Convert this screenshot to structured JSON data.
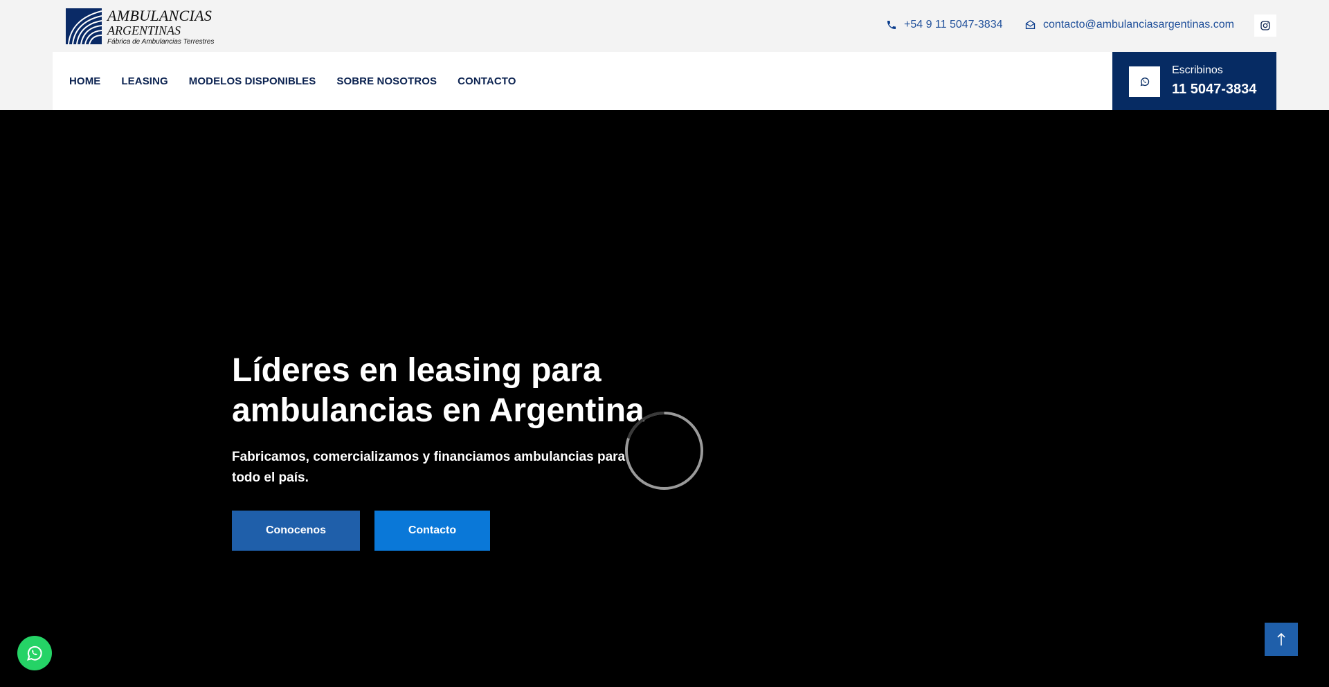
{
  "brand": {
    "line1": "AMBULANCIAS",
    "line2": "ARGENTINAS",
    "line3": "Fábrica de Ambulancias Terrestres"
  },
  "topbar": {
    "phone": "+54 9 11 5047-3834",
    "email": "contacto@ambulanciasargentinas.com",
    "phone_icon": "phone-icon",
    "email_icon": "envelope-icon",
    "social_icon": "instagram-icon"
  },
  "nav": {
    "items": [
      {
        "label": "HOME"
      },
      {
        "label": "LEASING"
      },
      {
        "label": "MODELOS DISPONIBLES"
      },
      {
        "label": "SOBRE NOSOTROS"
      },
      {
        "label": "CONTACTO"
      }
    ]
  },
  "whatsapp_box": {
    "label": "Escribinos",
    "number": "11 5047-3834",
    "icon": "whatsapp-icon"
  },
  "hero": {
    "title_line1": "Líderes en leasing para",
    "title_line2": "ambulancias en Argentina",
    "subtitle_line1": "Fabricamos, comercializamos y financiamos ambulancias para",
    "subtitle_line2": "todo el país.",
    "btn_primary": "Conocenos",
    "btn_secondary": "Contacto"
  },
  "floating": {
    "whatsapp_icon": "whatsapp-icon",
    "scroll_icon": "arrow-up-icon"
  },
  "colors": {
    "navy": "#062b63",
    "nav_text": "#0b2250",
    "link_blue": "#1f4f9a",
    "btn_primary": "#1f5faa",
    "btn_secondary": "#0a78d8",
    "whatsapp_green": "#25d366"
  }
}
